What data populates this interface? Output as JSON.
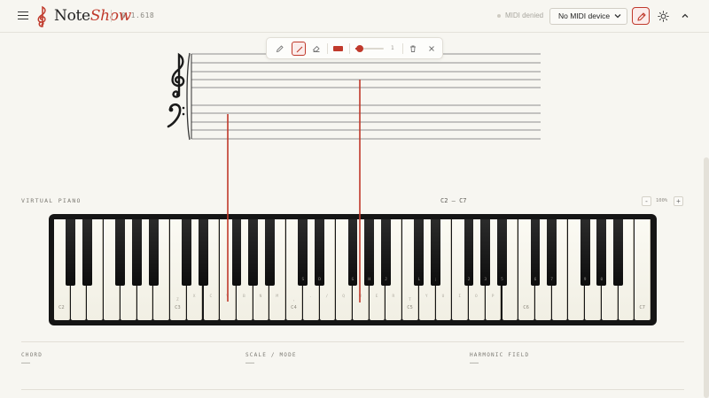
{
  "header": {
    "brand_note": "Note",
    "brand_show": "Show",
    "version": "0 1.618",
    "midi_status": "MIDI denied",
    "midi_device": "No MIDI device"
  },
  "toolbar": {
    "stroke_color": "#c0392b",
    "stroke_width_value": 0.15,
    "stroke_width_label": "1"
  },
  "piano": {
    "section_label": "VIRTUAL PIANO",
    "range_label": "C2 – C7",
    "zoom_out_label": "-",
    "zoom_in_label": "+",
    "zoom_value": "100%",
    "octave_labels": [
      "C2",
      "C3",
      "C4",
      "C5",
      "C6",
      "C7"
    ],
    "white_key_hints": [
      "Z",
      "X",
      "C",
      "V",
      "B",
      "N",
      "M",
      ",",
      ".",
      "/",
      "Q",
      "W",
      "E",
      "R",
      "T",
      "Y",
      "U",
      "I",
      "O",
      "P"
    ],
    "black_key_hints": [
      "S",
      "D",
      "G",
      "H",
      "J",
      "L",
      ";",
      "2",
      "3",
      "5",
      "6",
      "7",
      "9",
      "0"
    ]
  },
  "info": {
    "chord_label": "CHORD",
    "chord_value": "—",
    "scale_label": "SCALE / MODE",
    "scale_value": "—",
    "harmonic_label": "HARMONIC FIELD",
    "harmonic_value": "—"
  },
  "colors": {
    "accent": "#c0392b",
    "background": "#f7f6f1"
  }
}
